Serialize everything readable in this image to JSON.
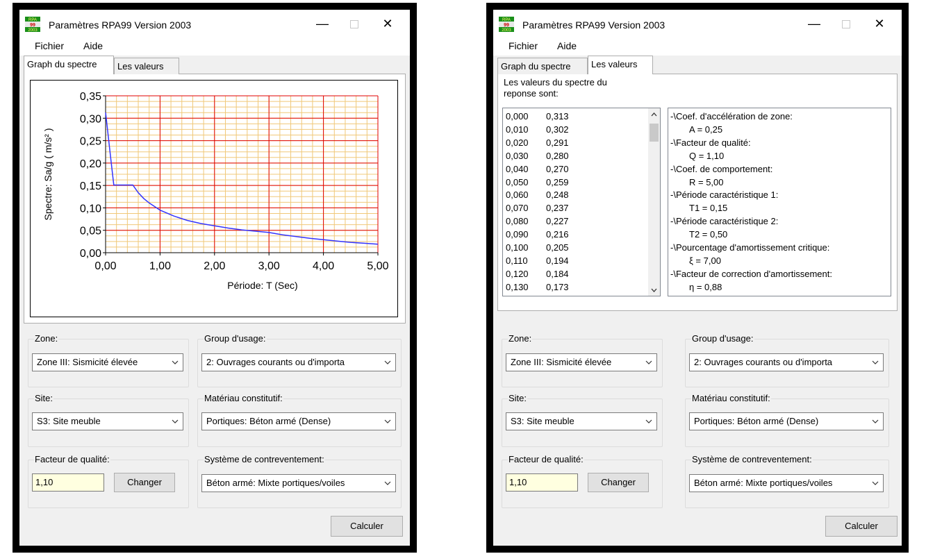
{
  "window": {
    "title": "Paramètres RPA99 Version 2003",
    "icon_lines": [
      "RPA",
      "99",
      "2003"
    ],
    "minimize": "—",
    "close": "✕"
  },
  "menu": [
    "Fichier",
    "Aide"
  ],
  "tabs": [
    "Graph du spectre",
    "Les valeurs"
  ],
  "chart_data": {
    "type": "line",
    "xlabel": "Période: T (Sec)",
    "ylabel": "Spectre: Sa/g ( m/s² )",
    "xlim": [
      0,
      5
    ],
    "ylim": [
      0,
      0.35
    ],
    "x_ticks": [
      "0,00",
      "1,00",
      "2,00",
      "3,00",
      "4,00",
      "5,00"
    ],
    "y_ticks": [
      "0,00",
      "0,05",
      "0,10",
      "0,15",
      "0,20",
      "0,25",
      "0,30",
      "0,35"
    ],
    "grid": true,
    "series": [
      {
        "color": "#3333ff",
        "x": [
          0,
          0.05,
          0.1,
          0.15,
          0.2,
          0.3,
          0.4,
          0.5,
          0.6,
          0.7,
          0.8,
          1.0,
          1.25,
          1.5,
          1.75,
          2.0,
          2.25,
          2.5,
          2.75,
          3.0,
          3.25,
          3.5,
          3.75,
          4.0,
          4.25,
          4.5,
          4.75,
          5.0
        ],
        "y": [
          0.313,
          0.259,
          0.205,
          0.151,
          0.151,
          0.151,
          0.151,
          0.151,
          0.134,
          0.121,
          0.111,
          0.095,
          0.082,
          0.072,
          0.065,
          0.06,
          0.055,
          0.051,
          0.048,
          0.045,
          0.04,
          0.036,
          0.032,
          0.029,
          0.026,
          0.023,
          0.021,
          0.019
        ]
      }
    ]
  },
  "values_tab": {
    "heading": [
      "Les valeurs du spectre du",
      "reponse sont:"
    ],
    "rows": [
      [
        "0,000",
        "0,313"
      ],
      [
        "0,010",
        "0,302"
      ],
      [
        "0,020",
        "0,291"
      ],
      [
        "0,030",
        "0,280"
      ],
      [
        "0,040",
        "0,270"
      ],
      [
        "0,050",
        "0,259"
      ],
      [
        "0,060",
        "0,248"
      ],
      [
        "0,070",
        "0,237"
      ],
      [
        "0,080",
        "0,227"
      ],
      [
        "0,090",
        "0,216"
      ],
      [
        "0,100",
        "0,205"
      ],
      [
        "0,110",
        "0,194"
      ],
      [
        "0,120",
        "0,184"
      ],
      [
        "0,130",
        "0,173"
      ]
    ],
    "params": [
      [
        "-\\Coef. d'accélération de zone:",
        "A = 0,25"
      ],
      [
        "-\\Facteur de qualité:",
        "Q = 1,10"
      ],
      [
        "-\\Coef. de comportement:",
        "R = 5,00"
      ],
      [
        "-\\Période caractéristique 1:",
        "T1 = 0,15"
      ],
      [
        "-\\Période caractéristique 2:",
        "T2 = 0,50"
      ],
      [
        "-\\Pourcentage d'amortissement critique:",
        "ξ = 7,00"
      ],
      [
        "-\\Facteur de correction d'amortissement:",
        "η = 0,88"
      ]
    ]
  },
  "form": {
    "zone": {
      "label": "Zone:",
      "value": "Zone III: Sismicité élevée"
    },
    "group": {
      "label": "Group d'usage:",
      "value": "2: Ouvrages courants ou d'importa"
    },
    "site": {
      "label": "Site:",
      "value": "S3: Site meuble"
    },
    "materiau": {
      "label": "Matériau constitutif:",
      "value": "Portiques: Béton armé (Dense)"
    },
    "qualite": {
      "label": "Facteur de qualité:",
      "value": "1,10",
      "button": "Changer"
    },
    "systeme": {
      "label": "Système de contreventement:",
      "value": "Béton armé: Mixte portiques/voiles"
    },
    "calculer": "Calculer"
  }
}
